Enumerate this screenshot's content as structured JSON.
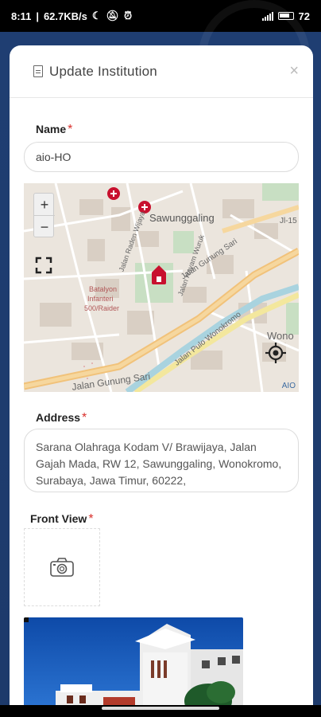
{
  "status_bar": {
    "time": "8:11",
    "speed": "62.7KB/s",
    "battery": "72"
  },
  "modal": {
    "title": "Update Institution",
    "close_glyph": "×"
  },
  "form": {
    "name_label": "Name",
    "required_mark": "*",
    "name_value": "aio-HO",
    "address_label": "Address",
    "address_value": "Sarana Olahraga Kodam V/ Brawijaya, Jalan Gajah Mada, RW 12, Sawunggaling, Wonokromo, Surabaya, Jawa Timur, 60222,",
    "front_view_label": "Front View"
  },
  "map": {
    "zoom_in": "+",
    "zoom_out": "−",
    "labels": {
      "district": "Sawunggaling",
      "street_1": "Jalan Gunung Sari",
      "street_2": "Jalan Gunung Sari",
      "street_3": "Jalan Pulo Wonokromo",
      "street_4": "Jalan Raden Wijaya",
      "street_5": "Jalan Hayam Wuruk",
      "street_6": "Jl-15",
      "poi_1": "Batalyon",
      "poi_2": "Infanteri",
      "poi_3": "500/Raider",
      "district_2": "Wono"
    },
    "attribution": "AIO"
  },
  "icons": {
    "document": "document-icon",
    "close": "close-icon",
    "fullscreen": "fullscreen-icon",
    "locate": "crosshair-icon",
    "camera": "camera-icon",
    "hospital": "hospital-marker-icon"
  },
  "colors": {
    "accent_required": "#d9302c",
    "marker_red": "#c8102e"
  }
}
